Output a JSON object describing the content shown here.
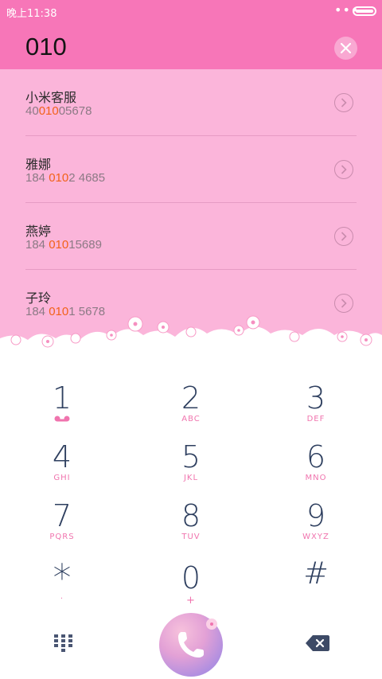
{
  "status": {
    "time": "晚上11:38",
    "dots": "•••"
  },
  "header": {
    "number": "010"
  },
  "results": [
    {
      "name": "小米客服",
      "phone_pre": "40",
      "phone_hl": "010",
      "phone_post": "05678"
    },
    {
      "name": "雅娜",
      "phone_pre": "184 ",
      "phone_hl": "010",
      "phone_post": "2 4685"
    },
    {
      "name": "燕婷",
      "phone_pre": "184 ",
      "phone_hl": "010",
      "phone_post": "15689"
    },
    {
      "name": "子玲",
      "phone_pre": "184 ",
      "phone_hl": "010",
      "phone_post": "1 5678"
    }
  ],
  "keys": [
    {
      "digit": "1",
      "letters": ""
    },
    {
      "digit": "2",
      "letters": "ABC"
    },
    {
      "digit": "3",
      "letters": "DEF"
    },
    {
      "digit": "4",
      "letters": "GHI"
    },
    {
      "digit": "5",
      "letters": "JKL"
    },
    {
      "digit": "6",
      "letters": "MNO"
    },
    {
      "digit": "7",
      "letters": "PQRS"
    },
    {
      "digit": "8",
      "letters": "TUV"
    },
    {
      "digit": "9",
      "letters": "WXYZ"
    },
    {
      "digit": "*",
      "letters": "·"
    },
    {
      "digit": "0",
      "letters": "+"
    },
    {
      "digit": "#",
      "letters": ""
    }
  ],
  "colors": {
    "accent": "#f776b8",
    "highlight": "#f2621a",
    "digit": "#2e3f5f",
    "letters": "#f074ae"
  },
  "icons": {
    "clear": "close-icon",
    "detail": "chevron-right-icon",
    "dialpad": "dialpad-icon",
    "call": "phone-icon",
    "backspace": "backspace-icon",
    "voicemail": "voicemail-icon"
  }
}
